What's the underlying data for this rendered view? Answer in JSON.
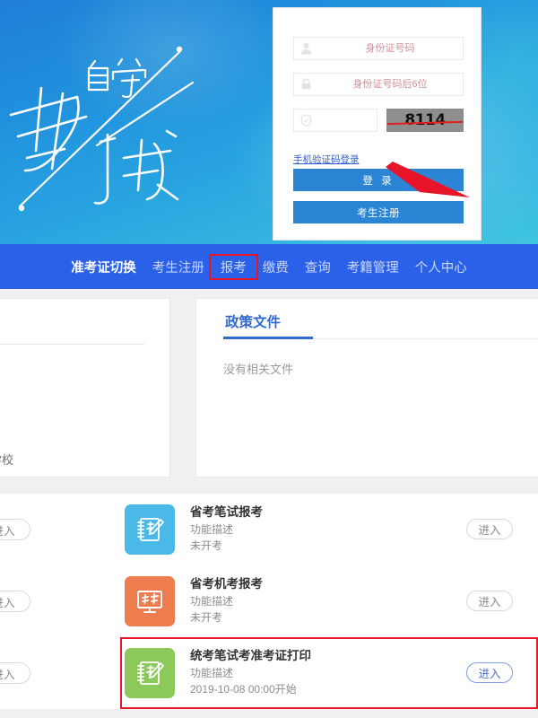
{
  "banner": {
    "hero_text_top": "自学",
    "hero_text_main_1": "考",
    "hero_text_main_2": "试",
    "alt": "自学考试"
  },
  "login": {
    "id_field": {
      "placeholder": "身份证号码",
      "value": "",
      "icon": "user-icon"
    },
    "pwd_field": {
      "placeholder": "身份证号码后6位",
      "value": "",
      "icon": "lock-icon"
    },
    "captcha_field": {
      "placeholder": "",
      "value": "",
      "icon": "shield-icon"
    },
    "captcha_image_text": "8114",
    "phone_login_link": "手机验证码登录",
    "login_button": "登 录",
    "register_button": "考生注册",
    "accent_color": "#2b85d4",
    "placeholder_color": "#d28f9a",
    "annotation_color": "#e8142a"
  },
  "nav": {
    "background": "#2b61e8",
    "items": [
      {
        "label": "准考证切换",
        "active": true,
        "highlighted": false
      },
      {
        "label": "考生注册",
        "active": false,
        "highlighted": false
      },
      {
        "label": "报考",
        "active": false,
        "highlighted": true
      },
      {
        "label": "缴费",
        "active": false,
        "highlighted": false
      },
      {
        "label": "查询",
        "active": false,
        "highlighted": false
      },
      {
        "label": "考籍管理",
        "active": false,
        "highlighted": false
      },
      {
        "label": "个人中心",
        "active": false,
        "highlighted": false
      }
    ]
  },
  "left_panel": {
    "partial_text": "学校"
  },
  "policy_card": {
    "title": "政策文件",
    "empty_text": "没有相关文件",
    "title_color": "#3169d0"
  },
  "services": {
    "enter_label": "进入",
    "rows": [
      {
        "title": "省考笔试报考",
        "desc": "功能描述",
        "status": "未开考",
        "icon": "notebook-pencil-icon",
        "icon_color": "#4ab9e8",
        "enter_active": false,
        "highlighted": false
      },
      {
        "title": "省考机考报考",
        "desc": "功能描述",
        "status": "未开考",
        "icon": "monitor-exam-icon",
        "icon_color": "#ed7d4f",
        "enter_active": false,
        "highlighted": false
      },
      {
        "title": "统考笔试考准考证打印",
        "desc": "功能描述",
        "status": "2019-10-08 00:00开始",
        "icon": "notebook-pencil-icon",
        "icon_color": "#8bc95b",
        "enter_active": true,
        "highlighted": true
      }
    ]
  }
}
